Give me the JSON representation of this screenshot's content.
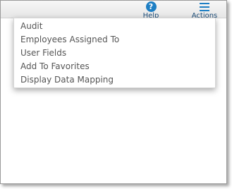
{
  "header": {
    "help_label": "Help",
    "actions_label": "Actions",
    "help_icon": "question-circle-icon",
    "actions_icon": "hamburger-menu-icon",
    "accent_color": "#1e7fc4"
  },
  "actions_menu": {
    "items": [
      {
        "label": "Audit"
      },
      {
        "label": "Employees Assigned To"
      },
      {
        "label": "User Fields"
      },
      {
        "label": "Add To Favorites"
      },
      {
        "label": "Display Data Mapping"
      }
    ]
  }
}
